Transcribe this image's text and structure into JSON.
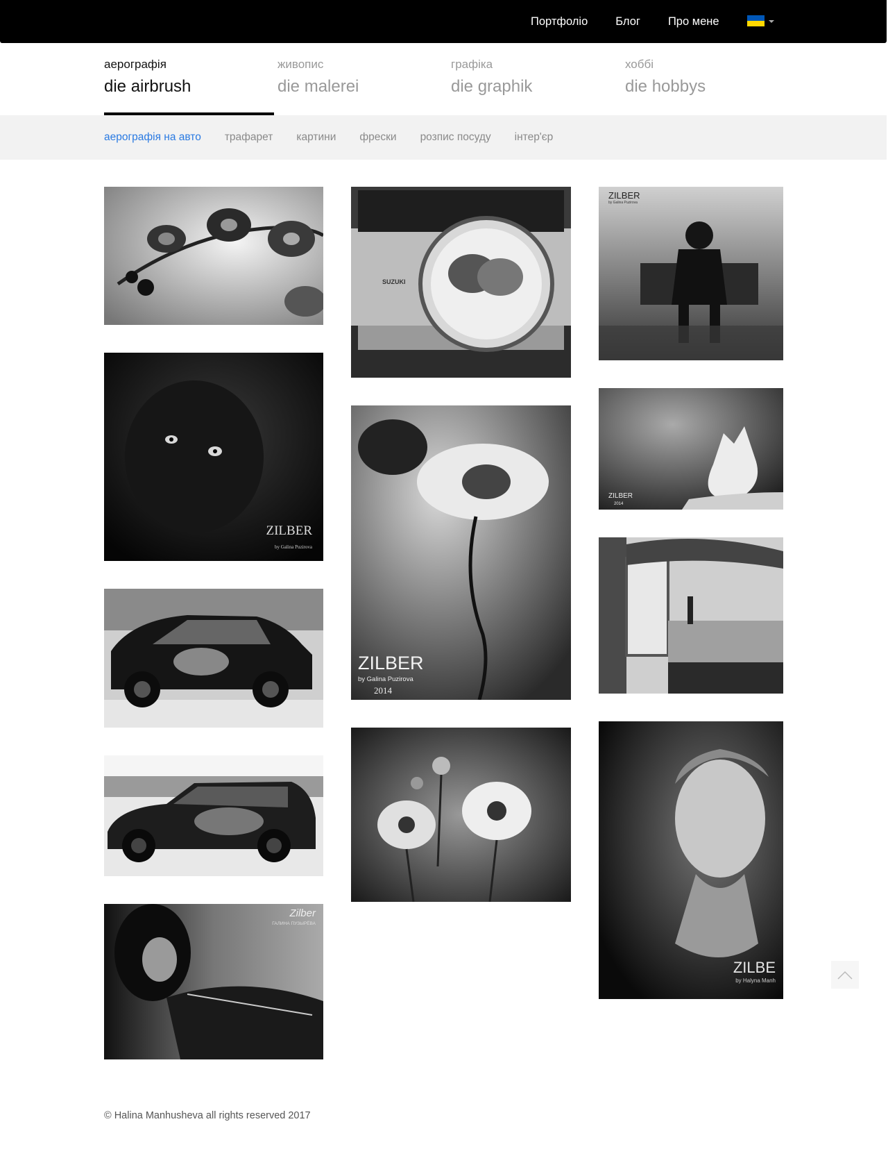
{
  "topnav": {
    "items": [
      {
        "label": "Портфоліо"
      },
      {
        "label": "Блог"
      },
      {
        "label": "Про мене"
      }
    ],
    "language_flag_colors": [
      "#0057b7",
      "#ffd700"
    ]
  },
  "categories": [
    {
      "small": "аерографія",
      "big": "die airbrush",
      "active": true
    },
    {
      "small": "живопис",
      "big": "die malerei",
      "active": false
    },
    {
      "small": "графіка",
      "big": "die graphik",
      "active": false
    },
    {
      "small": "хоббі",
      "big": "die hobbys",
      "active": false
    }
  ],
  "subnav": [
    {
      "label": "аерографія на авто",
      "active": true
    },
    {
      "label": "трафарет",
      "active": false
    },
    {
      "label": "картини",
      "active": false
    },
    {
      "label": "фрески",
      "active": false
    },
    {
      "label": "розпис посуду",
      "active": false
    },
    {
      "label": "інтер'єр",
      "active": false
    }
  ],
  "gallery": {
    "watermarks": {
      "panther": "ZILBER",
      "panther_sub": "by Galina Puzirova",
      "flower": "ZILBER",
      "flower_sub": "by Galina Puzirova",
      "flower_year": "2014",
      "man": "ZILBER",
      "man_sub": "by Galina Puzirova",
      "wolf": "ZILBER",
      "wolf_year": "2014",
      "portrait": "ZILBE",
      "portrait_sub": "by Halyna Manh",
      "violin": "Zilber",
      "violin_sub": "ГАЛИНА ПУЗЫРЁВА",
      "suzuki": "SUZUKI"
    }
  },
  "footer": {
    "text": "© Halina Manhusheva all rights reserved 2017"
  },
  "colors": {
    "accent": "#2a7ae2",
    "topbar": "#000000",
    "subnav_bg": "#f2f2f2"
  }
}
